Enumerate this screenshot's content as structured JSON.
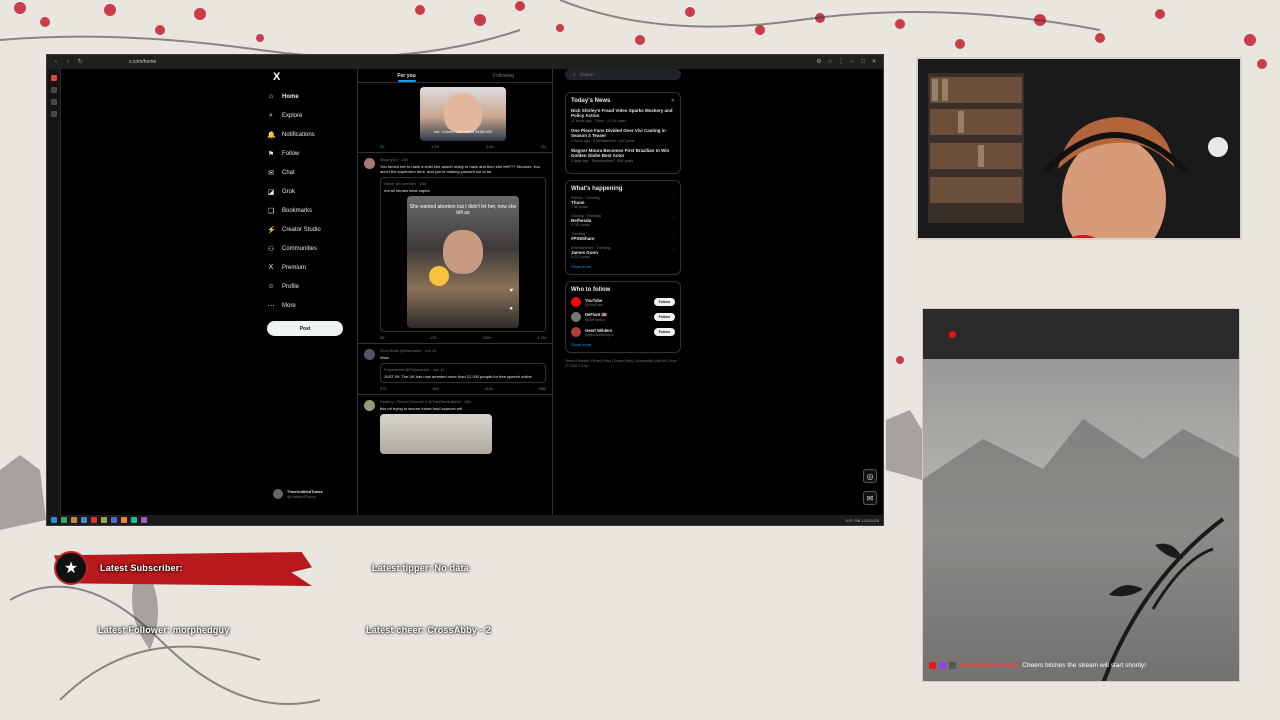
{
  "browser": {
    "url": "x.com/home",
    "clock": "4:07 PM 1/11/2025"
  },
  "nav": {
    "logo": "X",
    "items": [
      {
        "label": "Home",
        "icon": "home-icon",
        "glyph": "⌂"
      },
      {
        "label": "Explore",
        "icon": "search-icon",
        "glyph": "⌕"
      },
      {
        "label": "Notifications",
        "icon": "bell-icon",
        "glyph": "🔔"
      },
      {
        "label": "Follow",
        "icon": "follow-icon",
        "glyph": "⚑"
      },
      {
        "label": "Chat",
        "icon": "chat-icon",
        "glyph": "✉"
      },
      {
        "label": "Grok",
        "icon": "grok-icon",
        "glyph": "◪"
      },
      {
        "label": "Bookmarks",
        "icon": "bookmark-icon",
        "glyph": "❏"
      },
      {
        "label": "Creator Studio",
        "icon": "creator-studio-icon",
        "glyph": "⚡"
      },
      {
        "label": "Communities",
        "icon": "communities-icon",
        "glyph": "⚇"
      },
      {
        "label": "Premium",
        "icon": "premium-icon",
        "glyph": "X"
      },
      {
        "label": "Profile",
        "icon": "profile-icon",
        "glyph": "☺"
      },
      {
        "label": "More",
        "icon": "more-icon",
        "glyph": "⋯"
      }
    ],
    "post_label": "Post"
  },
  "account": {
    "name": "TheeUntitledTunes",
    "handle": "@UntitledTunes"
  },
  "feed": {
    "tabs": [
      "For you",
      "Following"
    ],
    "post1": {
      "caption": "Inc. Cohen, has raised $168,000",
      "actions": [
        "55",
        "1.2K",
        "3.6K",
        "1M"
      ]
    },
    "post2": {
      "author": "@carlyUn · 13h",
      "text": "You forced her to have a child she wasn't ready to have and then she left??? Shocker. You aren't the superhero here, and you're making yourself out to be",
      "quote_author": "Steve @LoveStev · 15h",
      "quote_text": "not all heroes wear capes",
      "media_caption": "She wanted abortion but I didn't let her, now she left us",
      "actions": [
        "68",
        "17K",
        "300K",
        "4.7M"
      ]
    },
    "post3": {
      "author": "Elon Musk @elonmusk · Jan 11",
      "text": "Wow",
      "quote_author": "Polymarket @Polymarket · Jan 11",
      "quote_text": "JUST IN: The UK has now arrested more than 12,000 people for free speech online.",
      "actions": [
        "57K",
        "36K",
        "148K",
        "38M"
      ]
    },
    "post4": {
      "author": "Destiny | Steven Bonnell II @TheOmniLiberal · 16h",
      "text": "this mf trying to secure future food sources wtf"
    }
  },
  "right": {
    "search_placeholder": "Search",
    "news_title": "Today's News",
    "news": [
      {
        "title": "Nick Shirley's Fraud Video Sparks Mockery and Policy Action",
        "sub": "11 hours ago · Other · 21.3K posts"
      },
      {
        "title": "One Piece Fans Divided Over Vivi Casting in Season 2 Teaser",
        "sub": "2 hours ago · Entertainment · 11K posts"
      },
      {
        "title": "Wagner Moura Becomes First Brazilian to Win Golden Globe Best Actor",
        "sub": "2 days ago · Entertainment · 50K posts"
      }
    ],
    "happening_title": "What's happening",
    "trends": [
      {
        "category": "Politics · Trending",
        "name": "Thune",
        "posts": "7.5K posts"
      },
      {
        "category": "Gaming · Trending",
        "name": "Bethesda",
        "posts": "4,781 posts"
      },
      {
        "category": "Trending",
        "name": "#PS5Share",
        "posts": ""
      },
      {
        "category": "Entertainment · Trending",
        "name": "James Gunn",
        "posts": "4,223 posts"
      }
    ],
    "show_more": "Show more",
    "follow_title": "Who to follow",
    "follow": [
      {
        "name": "YouTube",
        "handle": "@YouTube",
        "color": "#ff0000"
      },
      {
        "name": "DeFiant 🇺🇸",
        "handle": "@DeFiantLs",
        "color": "#777777"
      },
      {
        "name": "Geert Wilders",
        "handle": "@geertwilderspvv",
        "color": "#b33a3a"
      }
    ],
    "follow_button": "Follow",
    "footer": "Terms of Service | Privacy Policy | Cookie Policy | Accessibility | Ads info | More ··· | © 2025 X Corp."
  },
  "stream": {
    "latest_subscriber": "Latest Subscriber:",
    "latest_tipper": "Latest tipper: No data",
    "latest_follower": "Latest Follower: morphedguy",
    "latest_cheer": "Latest cheer: CrossAbby - 2",
    "chat_user": "TheeUntitledTunes:",
    "chat_message": "Cheers bitches the stream will start shortly!"
  },
  "colors": {
    "accent": "#1d9bf0",
    "overlay_red": "#b8191d"
  }
}
